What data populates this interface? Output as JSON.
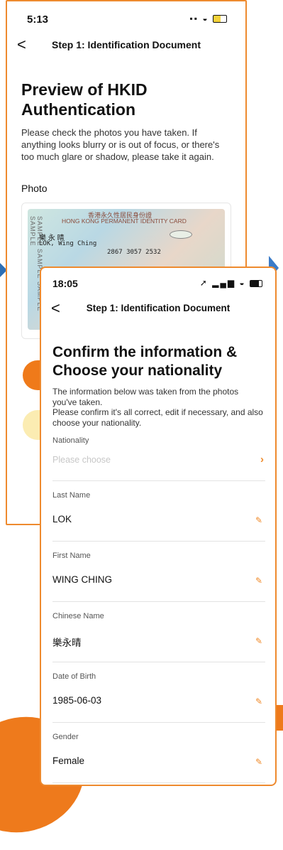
{
  "back_screen": {
    "status_time": "5:13",
    "nav_back": "<",
    "nav_title": "Step 1: Identification Document",
    "heading": "Preview of HKID Authentication",
    "description": "Please check the photos you have taken. If anything looks blurry or is out of focus, or there's too much glare or shadow, please take it again.",
    "photo_label": "Photo",
    "id_card": {
      "watermark": "SAMPLE SAMPLE SAMPLE SAMPLE",
      "issuer_zh": "香港永久性居民身份證",
      "issuer_en": "HONG KONG PERMANENT IDENTITY CARD",
      "name_zh": "樂 永 晴",
      "name_en": "LOK, Wing Ching",
      "code": "2867 3057 2532"
    }
  },
  "front_screen": {
    "status_time": "18:05",
    "nav_back": "<",
    "nav_title": "Step 1: Identification Document",
    "heading": "Confirm the information & Choose your nationality",
    "description_1": "The information below was taken from the photos you've taken.",
    "description_2": "Please confirm it's all correct, edit if necessary, and also choose your nationality.",
    "fields": [
      {
        "label": "Nationality",
        "placeholder": "Please choose",
        "icon": "chevron-right-icon"
      },
      {
        "label": "Last Name",
        "value": "LOK",
        "icon": "pencil-icon"
      },
      {
        "label": "First Name",
        "value": "WING CHING",
        "icon": "pencil-icon"
      },
      {
        "label": "Chinese Name",
        "value": "樂永晴",
        "icon": "pencil-icon"
      },
      {
        "label": "Date of Birth",
        "value": "1985-06-03",
        "icon": "pencil-icon"
      },
      {
        "label": "Gender",
        "value": "Female",
        "icon": "pencil-icon"
      }
    ]
  },
  "colors": {
    "accent": "#ee8a2e",
    "primary_button": "#ef7a1a",
    "secondary_button": "#fbecb2",
    "arrow": "#3a7bc8"
  }
}
